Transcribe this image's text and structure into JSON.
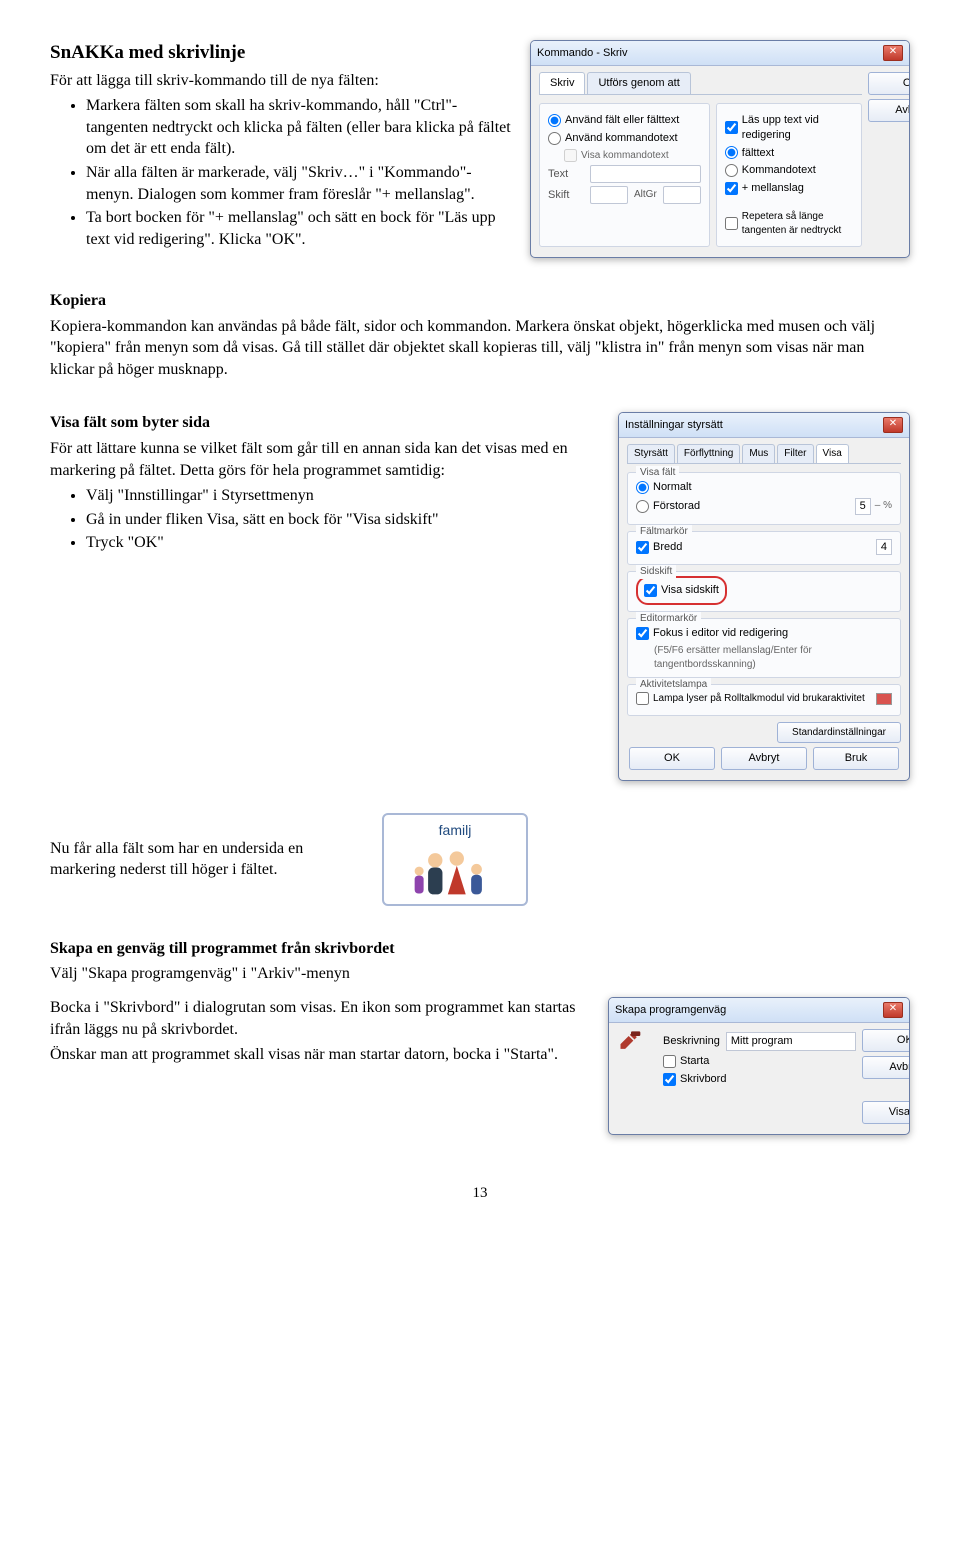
{
  "page_number": "13",
  "s1": {
    "header": "SnAKKa med skrivlinje",
    "intro": "För att lägga till skriv-kommando till de nya fälten:",
    "bullets": [
      "Markera fälten som skall ha skriv-kommando, håll \"Ctrl\"-tangenten nedtryckt och klicka på fälten (eller bara klicka på fältet om det är ett enda fält).",
      "När alla fälten är markerade, välj \"Skriv…\" i \"Kommando\"-menyn. Dialogen som kommer fram föreslår \"+ mellanslag\".",
      "Ta bort bocken för \"+ mellanslag\" och sätt en bock för \"Läs upp text vid redigering\". Klicka \"OK\"."
    ]
  },
  "dlg1": {
    "title": "Kommando - Skriv",
    "tabs": [
      "Skriv",
      "Utförs genom att"
    ],
    "ok": "OK",
    "cancel": "Avbryt",
    "las_upp": "Läs upp text vid redigering",
    "opt_anv_falt": "Använd fält eller fälttext",
    "opt_anv_kmd": "Använd kommandotext",
    "visa_kmd": "Visa kommandotext",
    "falttext": "fälttext",
    "kommandotext": "Kommandotext",
    "mellanslag": "+ mellanslag",
    "text_lbl": "Text",
    "skift_lbl": "Skift",
    "altgr_lbl": "AltGr",
    "repetera": "Repetera så länge tangenten är nedtryckt"
  },
  "s2": {
    "header": "Kopiera",
    "body": "Kopiera-kommandon kan användas på både fält, sidor och kommandon. Markera önskat objekt, högerklicka med musen och välj \"kopiera\" från menyn som då visas. Gå till stället där objektet skall kopieras till, välj \"klistra in\" från menyn som visas när man klickar på höger musknapp."
  },
  "s3": {
    "header": "Visa fält som byter sida",
    "intro": "För att lättare kunna se vilket fält som går till en annan sida kan det visas med en markering på fältet. Detta görs för hela programmet samtidig:",
    "bullets": [
      "Välj \"Innstillingar\" i Styrsettmenyn",
      "Gå in under fliken Visa, sätt en bock för \"Visa sidskift\"",
      "Tryck \"OK\""
    ]
  },
  "dlg2": {
    "title": "Inställningar styrsätt",
    "tabs": [
      "Styrsätt",
      "Förflyttning",
      "Mus",
      "Filter",
      "Visa"
    ],
    "grp_visafalt": "Visa fält",
    "normalt": "Normalt",
    "forstorad": "Förstorad",
    "forstorad_val": "5",
    "forstorad_pct": "– %",
    "grp_faltmarkor": "Fältmarkör",
    "bredd": "Bredd",
    "bredd_val": "4",
    "grp_sidskift": "Sidskift",
    "visa_sidskift": "Visa sidskift",
    "grp_editor": "Editormarkör",
    "fokus": "Fokus i editor vid redigering",
    "fokus_sub": "(F5/F6 ersätter mellanslag/Enter för tangentbordsskanning)",
    "grp_lampa": "Aktivitetslampa",
    "lampa": "Lampa lyser på Rolltalkmodul vid brukaraktivitet",
    "std": "Standardinställningar",
    "ok": "OK",
    "avbryt": "Avbryt",
    "bruk": "Bruk"
  },
  "familj": {
    "label": "familj"
  },
  "s3b": {
    "body": "Nu får alla fält som har en undersida en markering nederst till höger i fältet."
  },
  "s4": {
    "header": "Skapa en genväg till programmet från skrivbordet",
    "line1": "Välj \"Skapa programgenväg\" i \"Arkiv\"-menyn",
    "line2": "Bocka i \"Skrivbord\" i dialogrutan som visas. En ikon som programmet kan startas ifrån läggs nu på skrivbordet.",
    "line3": "Önskar man att programmet skall visas när man startar datorn, bocka i \"Starta\"."
  },
  "dlg3": {
    "title": "Skapa programgenväg",
    "ok": "OK",
    "avbryt": "Avbryt",
    "besk_lbl": "Beskrivning",
    "besk_val": "Mitt program",
    "starta": "Starta",
    "skrivbord": "Skrivbord",
    "visa": "Visa…"
  }
}
